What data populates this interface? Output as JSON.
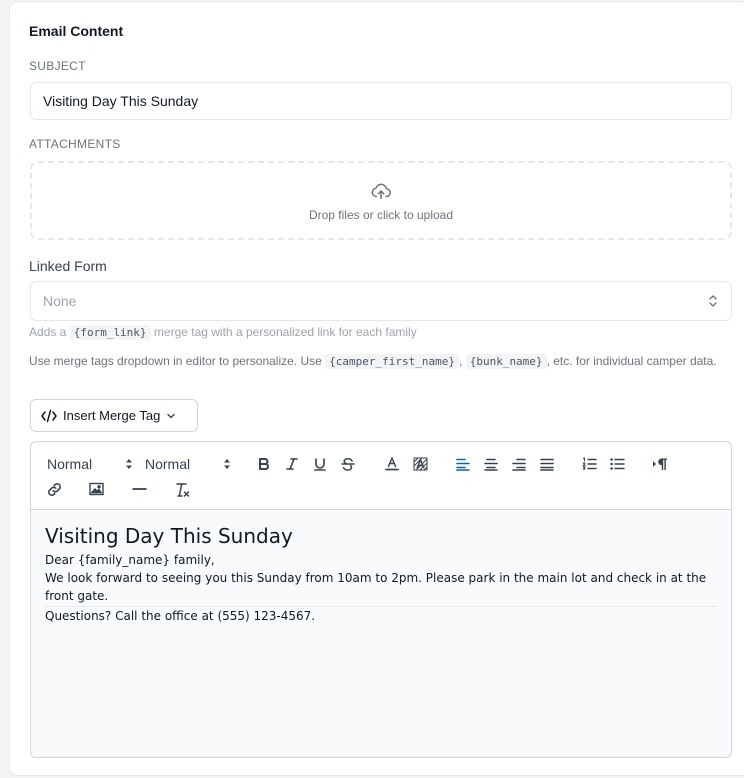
{
  "section_title": "Email Content",
  "subject": {
    "label": "SUBJECT",
    "value": "Visiting Day This Sunday"
  },
  "attachments": {
    "label": "ATTACHMENTS",
    "dropzone_text": "Drop files or click to upload",
    "icon": "cloud-upload-icon"
  },
  "linked_form": {
    "label": "Linked Form",
    "selected": "None",
    "helper_prefix": "Adds a",
    "helper_tag": "{form_link}",
    "helper_suffix": "merge tag with a personalized link for each family"
  },
  "merge_note": {
    "prefix": "Use merge tags dropdown in editor to personalize. Use",
    "tag1": "{camper_first_name}",
    "sep": ",",
    "tag2": "{bunk_name}",
    "suffix": ", etc. for individual camper data."
  },
  "insert_merge_tag": {
    "label": "Insert Merge Tag"
  },
  "toolbar": {
    "heading_picker": "Normal",
    "size_picker": "Normal",
    "buttons": [
      "bold",
      "italic",
      "underline",
      "strike",
      "font-color",
      "background-color",
      "align-left",
      "align-center",
      "align-right",
      "align-justify",
      "ordered-list",
      "bullet-list",
      "text-direction",
      "link",
      "image",
      "horizontal-rule",
      "clear-format"
    ]
  },
  "editor": {
    "heading": "Visiting Day This Sunday",
    "greeting": "Dear {family_name} family,",
    "body": "We look forward to seeing you this Sunday from 10am to 2pm. Please park in the main lot and check in at the front gate.",
    "footer": "Questions? Call the office at (555) 123-4567."
  },
  "colors": {
    "accent": "#0369a1",
    "border": "#e5e7eb",
    "muted": "#9ca3af"
  }
}
